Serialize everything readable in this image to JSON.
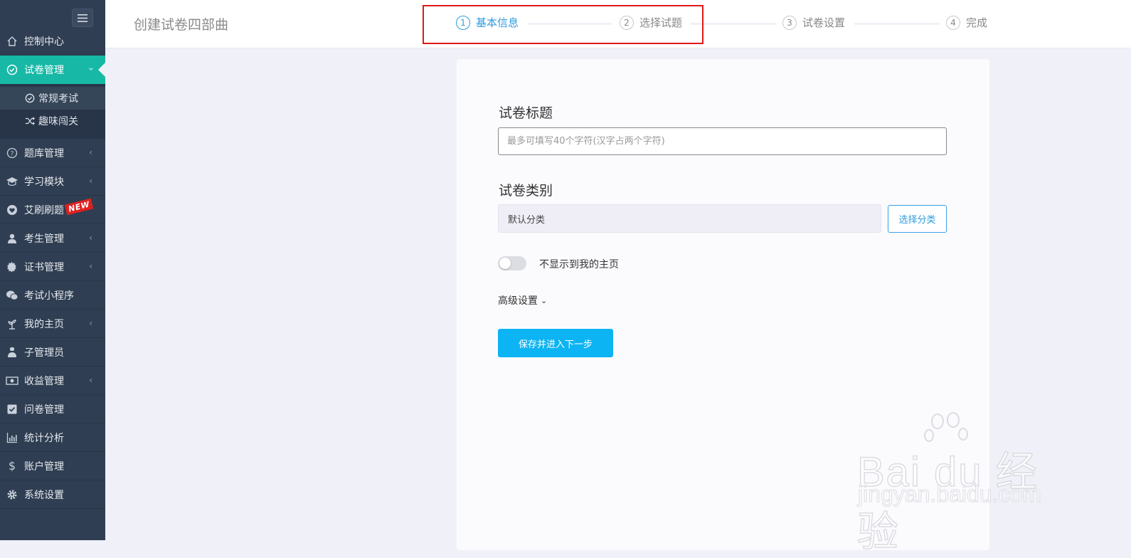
{
  "sidebar": {
    "items": [
      {
        "label": "控制中心",
        "icon": "home-icon"
      },
      {
        "label": "试卷管理",
        "icon": "check-circle-icon",
        "active": true
      },
      {
        "label": "题库管理",
        "icon": "question-circle-icon"
      },
      {
        "label": "学习模块",
        "icon": "graduation-cap-icon"
      },
      {
        "label": "艾刷刷题",
        "icon": "heart-badge-icon",
        "badge": "NEW"
      },
      {
        "label": "考生管理",
        "icon": "user-icon"
      },
      {
        "label": "证书管理",
        "icon": "certificate-icon"
      },
      {
        "label": "考试小程序",
        "icon": "wechat-icon"
      },
      {
        "label": "我的主页",
        "icon": "plant-icon"
      },
      {
        "label": "子管理员",
        "icon": "admin-user-icon"
      },
      {
        "label": "收益管理",
        "icon": "money-icon"
      },
      {
        "label": "问卷管理",
        "icon": "checkbox-icon"
      },
      {
        "label": "统计分析",
        "icon": "bar-chart-icon"
      },
      {
        "label": "账户管理",
        "icon": "dollar-icon"
      },
      {
        "label": "系统设置",
        "icon": "gear-icon"
      }
    ],
    "submenu": [
      {
        "label": "常规考试",
        "icon": "check-circle-icon"
      },
      {
        "label": "趣味闯关",
        "icon": "shuffle-icon"
      }
    ]
  },
  "header": {
    "title": "创建试卷四部曲",
    "steps": [
      {
        "num": "1",
        "label": "基本信息"
      },
      {
        "num": "2",
        "label": "选择试题"
      },
      {
        "num": "3",
        "label": "试卷设置"
      },
      {
        "num": "4",
        "label": "完成"
      }
    ]
  },
  "form": {
    "title_label": "试卷标题",
    "title_placeholder": "最多可填写40个字符(汉字占两个字符)",
    "title_value": "",
    "category_label": "试卷类别",
    "category_value": "默认分类",
    "select_category_button": "选择分类",
    "hide_from_homepage_label": "不显示到我的主页",
    "hide_from_homepage_on": false,
    "advanced_settings": "高级设置",
    "save_next_button": "保存并进入下一步"
  },
  "watermark": {
    "line1": "Bai du 经验",
    "line2": "jingyan.baidu.com"
  },
  "colors": {
    "sidebar_bg": "#2f3e52",
    "active_menu": "#17b8a6",
    "primary_button": "#0db4f3",
    "step_active": "#2f9bdc",
    "highlight_box": "#e01818"
  }
}
